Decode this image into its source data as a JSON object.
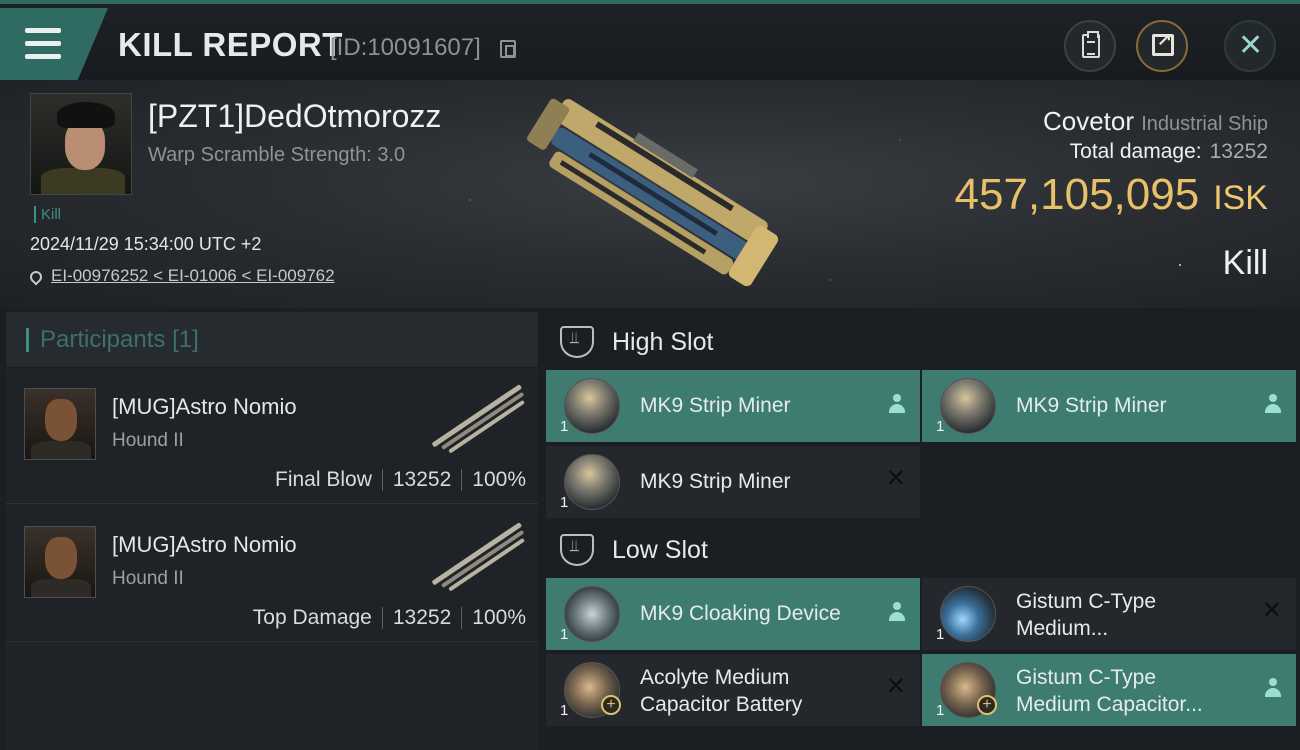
{
  "topbar": {
    "title": "KILL REPORT",
    "report_id": "[ID:10091607]"
  },
  "victim": {
    "name": "[PZT1]DedOtmorozz",
    "warp_scramble": "Warp Scramble Strength: 3.0",
    "kill_tag": "Kill",
    "datetime": "2024/11/29 15:34:00 UTC +2",
    "location": "EI-00976252 < EI-01006 < EI-009762"
  },
  "ship": {
    "name": "Covetor",
    "class": "Industrial Ship",
    "total_damage_label": "Total damage:",
    "total_damage_value": "13252",
    "isk_value": "457,105,095",
    "isk_unit": "ISK",
    "result": "Kill"
  },
  "participants": {
    "label": "Participants",
    "count": "[1]",
    "rows": [
      {
        "name": "[MUG]Astro Nomio",
        "ship": "Hound II",
        "role": "Final Blow",
        "damage": "13252",
        "percent": "100%"
      },
      {
        "name": "[MUG]Astro Nomio",
        "ship": "Hound II",
        "role": "Top Damage",
        "damage": "13252",
        "percent": "100%"
      }
    ]
  },
  "slots": {
    "high_label": "High Slot",
    "low_label": "Low Slot",
    "modules": [
      {
        "name": "MK9 Strip Miner",
        "qty": "1"
      },
      {
        "name": "MK9 Strip Miner",
        "qty": "1"
      },
      {
        "name": "MK9 Strip Miner",
        "qty": "1"
      },
      {
        "name": "MK9 Cloaking Device",
        "qty": "1"
      },
      {
        "name": "Gistum C-Type Medium...",
        "qty": "1"
      },
      {
        "name": "Acolyte Medium Capacitor Battery",
        "qty": "1"
      },
      {
        "name": "Gistum C-Type Medium Capacitor...",
        "qty": "1"
      }
    ]
  },
  "colors": {
    "accent": "#3e8f84",
    "isk": "#e8c06a",
    "module_active": "#3e7c72"
  }
}
